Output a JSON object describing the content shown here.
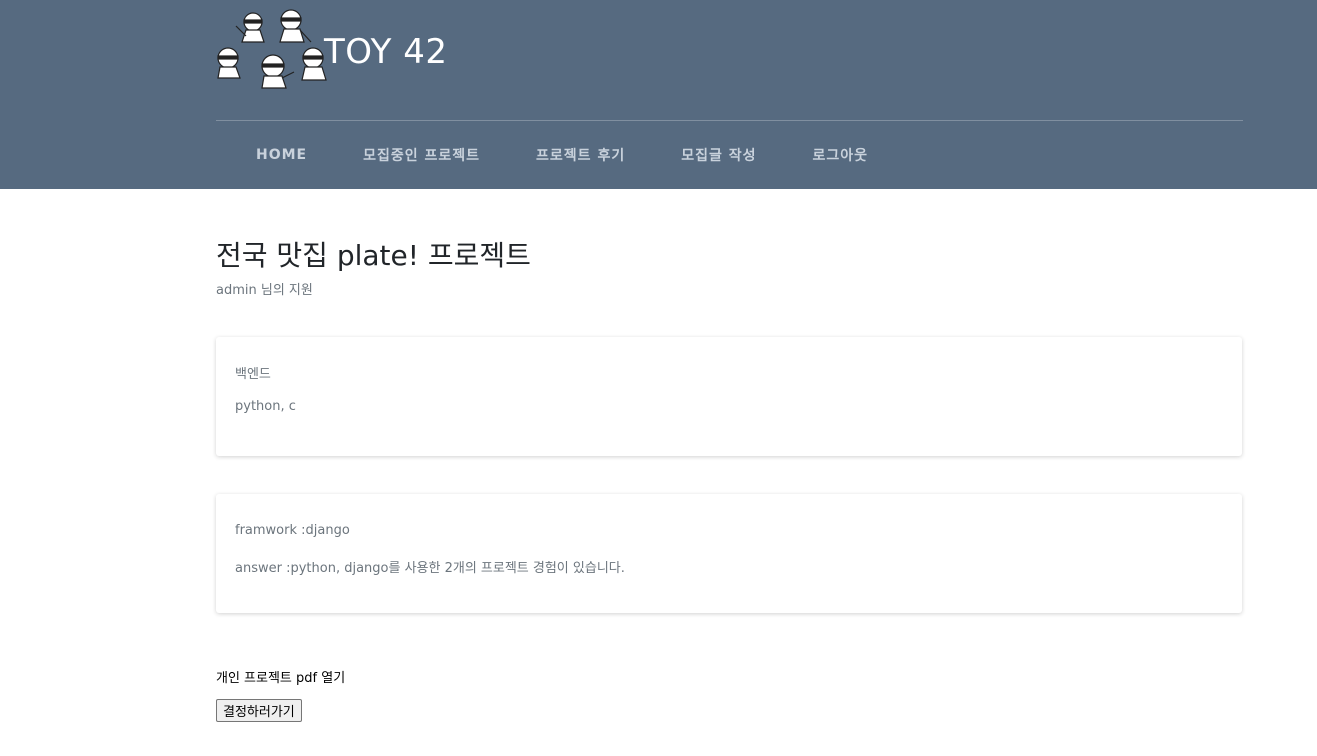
{
  "header": {
    "brand_title": "TOY 42",
    "logo_icon": "ninja-group-logo-icon",
    "colors": {
      "background": "#566a80",
      "nav_text": "#c9d2dc"
    }
  },
  "nav": {
    "items": [
      {
        "label": "HOME"
      },
      {
        "label": "모집중인 프로젝트"
      },
      {
        "label": "프로젝트 후기"
      },
      {
        "label": "모집글 작성"
      },
      {
        "label": "로그아웃"
      }
    ]
  },
  "main": {
    "title": "전국 맛집 plate! 프로젝트",
    "subtitle": "admin 님의 지원",
    "cards": [
      {
        "line1": "백엔드",
        "line2": "python, c"
      },
      {
        "line1": "framwork :django",
        "line2": "answer :python, django를 사용한 2개의 프로젝트 경험이 있습니다."
      }
    ],
    "pdf_link": "개인 프로젝트 pdf 열기",
    "decide_button": "결정하러가기"
  }
}
